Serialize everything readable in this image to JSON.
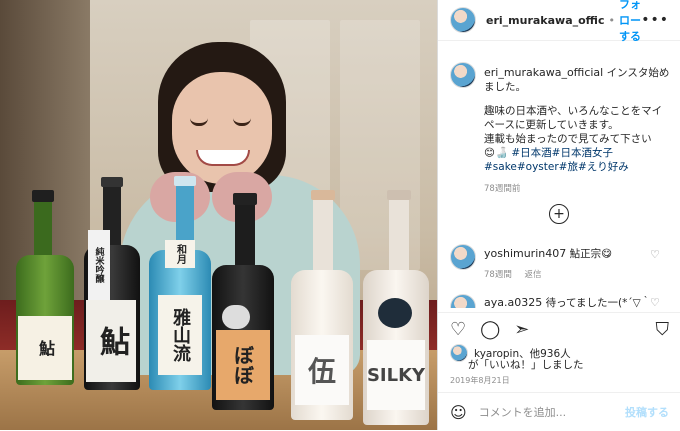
{
  "post": {
    "author": "eri_murakawa_offic",
    "author_full": "eri_murakawa_official",
    "follow_label": "フォローする",
    "more_icon": "more-icon",
    "caption_first": "インスタ始めました。",
    "caption_body": "趣味の日本酒や、いろんなことをマイペースに更新していきます。\n連載も始まったので見てみて下さい",
    "caption_emoji": "😊🍶",
    "caption_tags_1": "#日本酒#日本酒女子",
    "caption_tags_2": "#sake#oyster#旅#えり好み",
    "caption_age": "78週間前",
    "load_more_icon": "plus-circle-icon",
    "comments": [
      {
        "user": "yoshimurin407",
        "text": "鮎正宗😋",
        "age": "78週間",
        "reply": "返信"
      },
      {
        "user": "aya.a0325",
        "text": "待ってました一(*´▽｀",
        "age": "",
        "reply": ""
      }
    ],
    "likes_line1": "kyaropin、他936人",
    "likes_line2": "が「いいね！」しました",
    "date": "2019年8月21日",
    "comment_placeholder": "コメントを追加...",
    "post_button": "投稿する"
  },
  "photo": {
    "bottle_labels": [
      "",
      "純米吟醸",
      "雅山流",
      "ぼぼ",
      "伍",
      "SILKY"
    ],
    "bottle_label_sub": [
      "鮎",
      "",
      "和月",
      "",
      "",
      ""
    ]
  }
}
